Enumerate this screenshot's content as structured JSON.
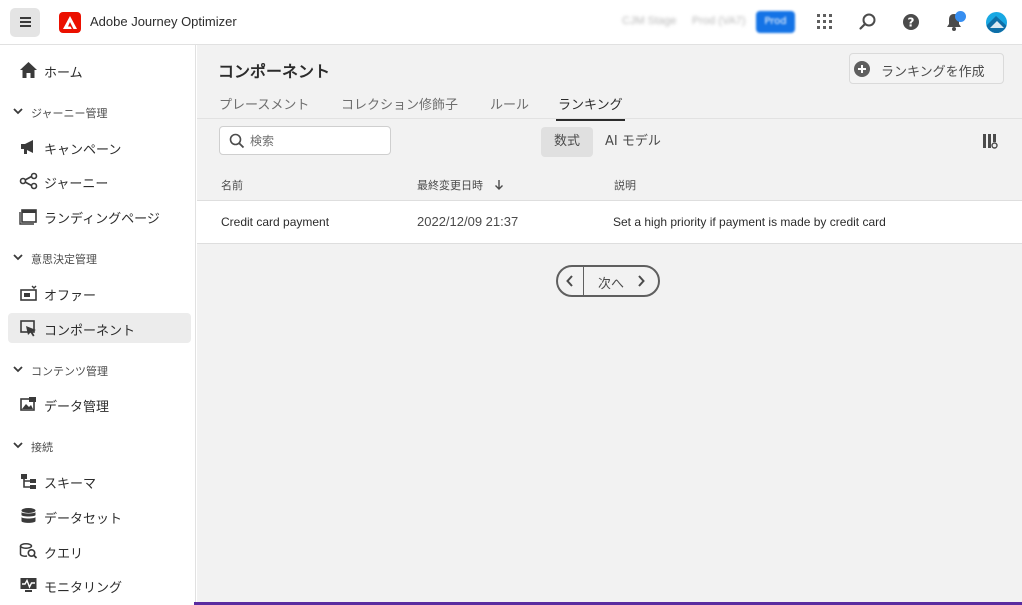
{
  "app": {
    "title": "Adobe Journey Optimizer",
    "blurred_org": "CJM Stage",
    "blurred_sandbox": "Prod (VA7)",
    "blurred_badge": "Prod",
    "accent_color": "#eb1000"
  },
  "sidebar": {
    "home": "ホーム",
    "sections": [
      {
        "label": "ジャーニー管理",
        "items": [
          "キャンペーン",
          "ジャーニー",
          "ランディングページ"
        ]
      },
      {
        "label": "意思決定管理",
        "items": [
          "オファー",
          "コンポーネント"
        ]
      },
      {
        "label": "コンテンツ管理",
        "items": [
          "データ管理"
        ]
      },
      {
        "label": "接続",
        "items": [
          "スキーマ",
          "データセット",
          "クエリ",
          "モニタリング"
        ]
      }
    ],
    "active_item": "コンポーネント"
  },
  "main": {
    "title": "コンポーネント",
    "create_button": "ランキングを作成",
    "tabs": [
      "プレースメント",
      "コレクション修飾子",
      "ルール",
      "ランキング"
    ],
    "selected_tab": "ランキング",
    "search_placeholder": "検索",
    "toggle": {
      "formula": "数式",
      "ai_model": "AI モデル",
      "selected": "数式"
    },
    "table": {
      "columns": [
        "名前",
        "最終変更日時",
        "説明"
      ],
      "sorted_column": "最終変更日時",
      "rows": [
        {
          "name": "Credit card payment",
          "modified": "2022/12/09 21:37",
          "description": "Set a high priority if payment is made by credit card"
        }
      ]
    },
    "pagination": {
      "next_label": "次へ"
    }
  }
}
